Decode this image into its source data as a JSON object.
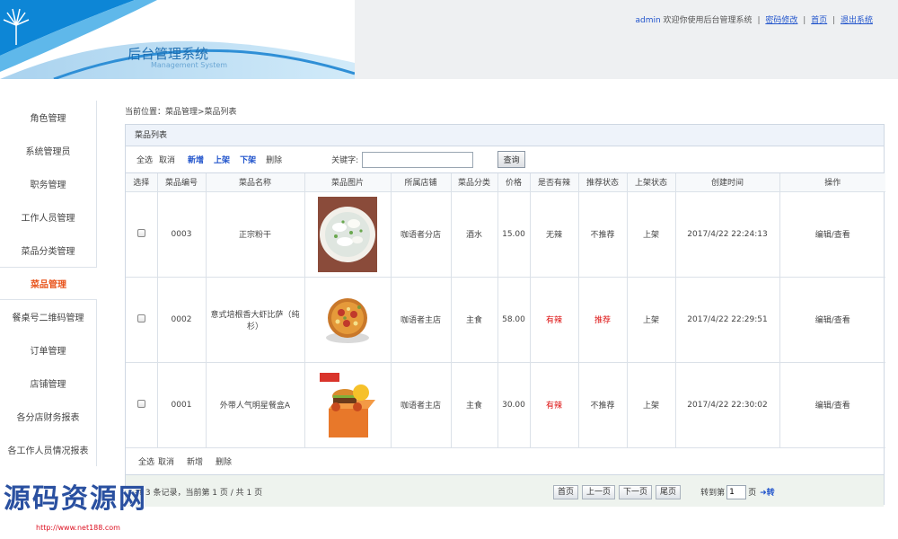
{
  "header": {
    "system_title": "后台管理系统",
    "system_subtitle": "Management System",
    "username": "admin",
    "welcome_text": "欢迎你使用后台管理系统",
    "links": [
      "密码修改",
      "首页",
      "退出系统"
    ]
  },
  "sidebar": {
    "items": [
      {
        "label": "角色管理",
        "active": false
      },
      {
        "label": "系统管理员",
        "active": false
      },
      {
        "label": "职务管理",
        "active": false
      },
      {
        "label": "工作人员管理",
        "active": false
      },
      {
        "label": "菜品分类管理",
        "active": false
      },
      {
        "label": "菜品管理",
        "active": true
      },
      {
        "label": "餐桌号二维码管理",
        "active": false
      },
      {
        "label": "订单管理",
        "active": false
      },
      {
        "label": "店铺管理",
        "active": false
      },
      {
        "label": "各分店财务报表",
        "active": false
      },
      {
        "label": "各工作人员情况报表",
        "active": false
      }
    ]
  },
  "breadcrumb": "当前位置：菜品管理>菜品列表",
  "panel_title": "菜品列表",
  "toolbar": {
    "select_all": "全选",
    "cancel": "取消",
    "add": "新增",
    "on_shelf": "上架",
    "off_shelf": "下架",
    "delete": "删除",
    "keyword_label": "关键字:",
    "keyword_value": "",
    "query": "查询"
  },
  "table": {
    "columns": [
      "选择",
      "菜品编号",
      "菜品名称",
      "菜品图片",
      "所属店铺",
      "菜品分类",
      "价格",
      "是否有辣",
      "推荐状态",
      "上架状态",
      "创建时间",
      "操作"
    ],
    "rows": [
      {
        "id": "0003",
        "name": "正宗粉干",
        "image": "dumpling-soup-image",
        "shop": "咖语者分店",
        "category": "酒水",
        "price": "15.00",
        "spicy": "无辣",
        "spicy_red": false,
        "recommend": "不推荐",
        "recommend_red": false,
        "shelf": "上架",
        "created": "2017/4/22 22:24:13",
        "action": "编辑/查看"
      },
      {
        "id": "0002",
        "name": "意式培根香大虾比萨（纯杉）",
        "image": "pizza-image",
        "shop": "咖语者主店",
        "category": "主食",
        "price": "58.00",
        "spicy": "有辣",
        "spicy_red": true,
        "recommend": "推荐",
        "recommend_red": true,
        "shelf": "上架",
        "created": "2017/4/22 22:29:51",
        "action": "编辑/查看"
      },
      {
        "id": "0001",
        "name": "外带人气明星餐盒A",
        "image": "burger-meal-image",
        "shop": "咖语者主店",
        "category": "主食",
        "price": "30.00",
        "spicy": "有辣",
        "spicy_red": true,
        "recommend": "不推荐",
        "recommend_red": false,
        "shelf": "上架",
        "created": "2017/4/22 22:30:02",
        "action": "编辑/查看"
      }
    ]
  },
  "bottom_actions": [
    "全选",
    "取消",
    "新增",
    "删除"
  ],
  "pagination": {
    "info": "共 3 条记录，当前第 1 页 / 共 1 页",
    "buttons": [
      "首页",
      "上一页",
      "下一页",
      "尾页"
    ],
    "goto_prefix": "转到第",
    "goto_value": "1",
    "goto_suffix": "页",
    "go": "➜转"
  },
  "watermark": {
    "text": "源码资源网",
    "url": "http://www.net188.com"
  },
  "colors": {
    "accent_blue": "#2255cc",
    "active_orange": "#e8541c",
    "alert_red": "#dd1111"
  }
}
